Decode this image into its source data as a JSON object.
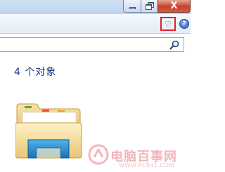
{
  "window": {
    "buttons": {
      "minimize_icon": "minimize-icon",
      "maximize_icon": "restore-icon",
      "close_label": "X"
    }
  },
  "toolbar": {
    "favorites_icon": "heart-icon",
    "favorites_glyph": "♡",
    "help_label": "?",
    "highlight_color": "#e0202a"
  },
  "search": {
    "value": "",
    "icon": "search-icon"
  },
  "content": {
    "item_count": "4 个对象",
    "folder_icon": "library-folder-icon"
  },
  "watermark": {
    "name": "电脑百事网",
    "url": "WWW.PC841.COM"
  },
  "colors": {
    "accent": "#1e3287",
    "close_button": "#c6422b"
  }
}
